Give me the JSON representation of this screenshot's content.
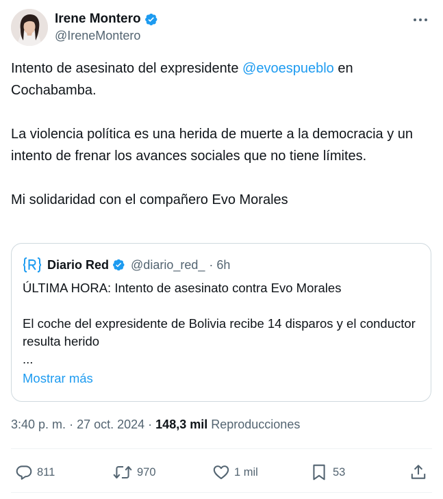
{
  "author": {
    "display_name": "Irene Montero",
    "handle": "@IreneMontero",
    "verified": true
  },
  "tweet": {
    "paragraphs": [
      {
        "before": "Intento de asesinato del expresidente ",
        "mention": "@evoespueblo",
        "after": " en Cochabamba."
      },
      {
        "text": "La violencia política es una herida de muerte a la democracia y un intento de frenar los avances sociales que no tiene límites."
      },
      {
        "text": "Mi solidaridad con el compañero Evo Morales"
      }
    ]
  },
  "quote": {
    "display_name": "Diario Red",
    "handle": "@diario_red_",
    "time": "· 6h",
    "lines": [
      "ÚLTIMA HORA: Intento de asesinato contra Evo Morales",
      "",
      "El coche del expresidente de Bolivia recibe 14 disparos y el conductor resulta herido",
      "..."
    ],
    "show_more": "Mostrar más"
  },
  "meta": {
    "time": "3:40 p. m.",
    "date": "27 oct. 2024",
    "views_count": "148,3 mil",
    "views_label": "Reproducciones"
  },
  "actions": {
    "reply_count": "811",
    "retweet_count": "970",
    "like_count": "1 mil",
    "bookmark_count": "53"
  },
  "icons": {
    "verified": "verified-badge-icon",
    "more": "more-horizontal-icon",
    "reply": "reply-icon",
    "retweet": "retweet-icon",
    "like": "heart-icon",
    "bookmark": "bookmark-icon",
    "share": "share-icon"
  },
  "colors": {
    "accent": "#1d9bf0",
    "text": "#0f1419",
    "secondary": "#536471",
    "border": "#cfd9de"
  }
}
